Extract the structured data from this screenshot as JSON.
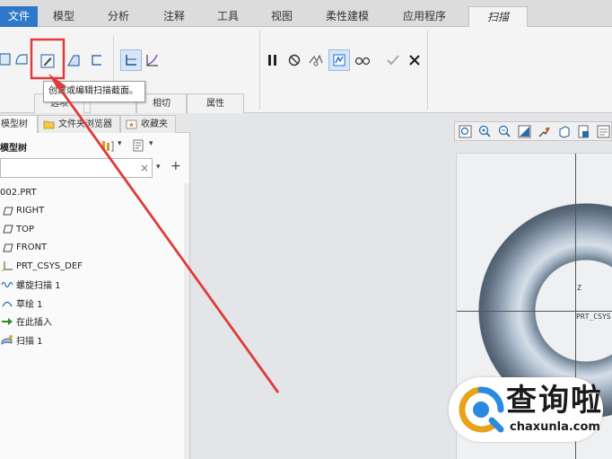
{
  "tabs": [
    {
      "label": "文件"
    },
    {
      "label": "模型"
    },
    {
      "label": "分析"
    },
    {
      "label": "注释"
    },
    {
      "label": "工具"
    },
    {
      "label": "视图"
    },
    {
      "label": "柔性建模"
    },
    {
      "label": "应用程序"
    },
    {
      "label": "扫描"
    }
  ],
  "ribbon": {
    "subtabs": [
      "选项",
      "相切",
      "属性"
    ],
    "tooltip": "创建或编辑扫描截面。"
  },
  "panel": {
    "tabs": [
      "模型树",
      "文件夹浏览器",
      "收藏夹"
    ],
    "tree_label": "模型树",
    "search_value": "",
    "clear_glyph": "×",
    "add_glyph": "+",
    "dropdown_glyph": "▾"
  },
  "tree": [
    {
      "label": "002.PRT",
      "icon": "part-icon"
    },
    {
      "label": "RIGHT",
      "icon": "datum-plane-icon"
    },
    {
      "label": "TOP",
      "icon": "datum-plane-icon"
    },
    {
      "label": "FRONT",
      "icon": "datum-plane-icon"
    },
    {
      "label": "PRT_CSYS_DEF",
      "icon": "csys-icon"
    },
    {
      "label": "螺旋扫描 1",
      "icon": "helical-sweep-icon"
    },
    {
      "label": "草绘 1",
      "icon": "sketch-icon"
    },
    {
      "label": "在此插入",
      "icon": "insert-arrow-icon"
    },
    {
      "label": "扫描 1",
      "icon": "sweep-icon"
    }
  ],
  "viewport": {
    "csys_label": "PRT_CSYS",
    "z_label": "Z"
  },
  "watermark": {
    "cn": "查询啦",
    "en": "chaxunla.com"
  },
  "colors": {
    "file_tab": "#2d78c8",
    "highlight": "#e03a3a",
    "accent_purple": "#7b48c8",
    "accent_blue": "#1e6fd0"
  }
}
